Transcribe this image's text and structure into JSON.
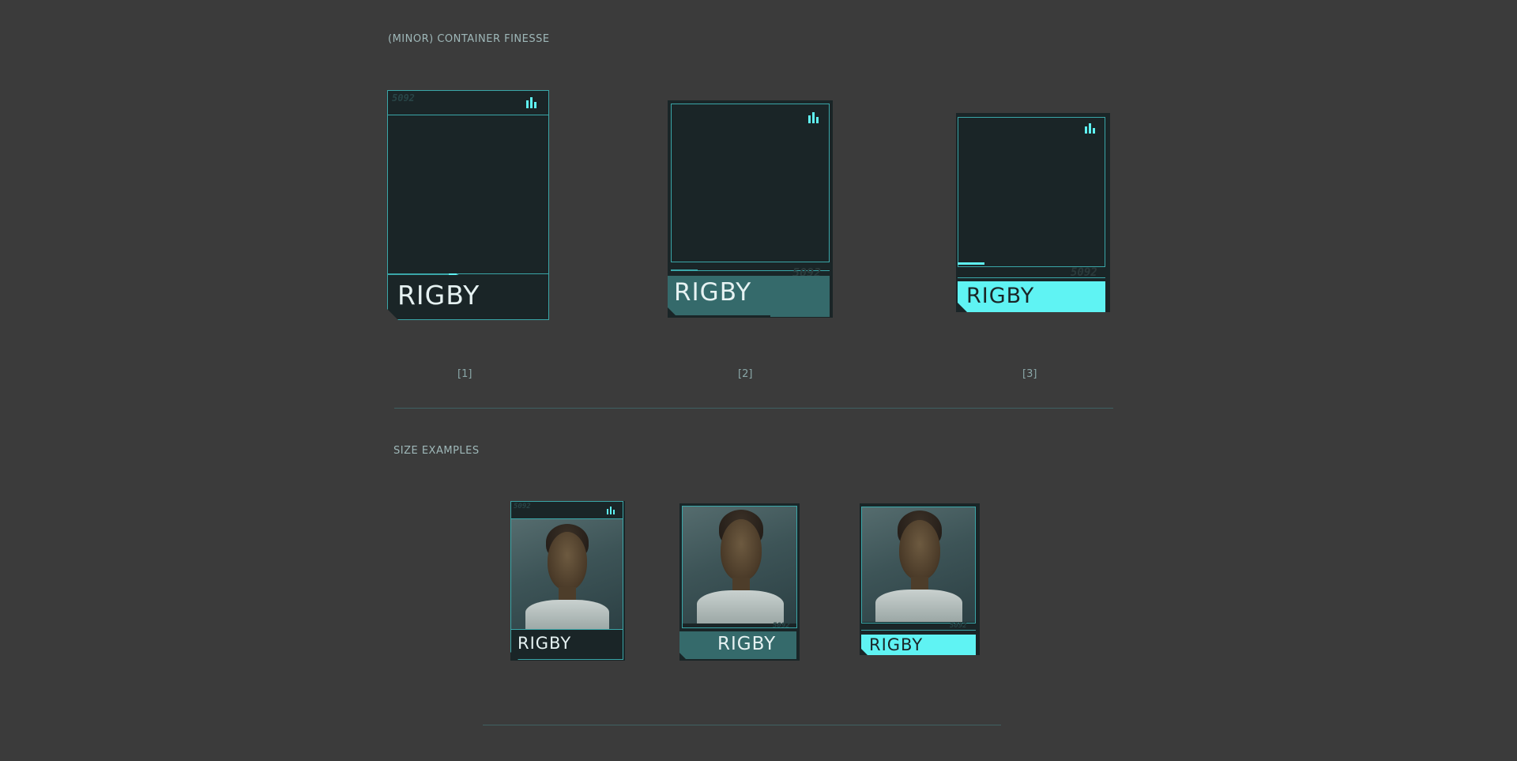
{
  "sections": {
    "finesse_title": "(MINOR) CONTAINER FINESSE",
    "size_title": "SIZE EXAMPLES"
  },
  "cards": [
    {
      "name": "RIGBY",
      "caption": "[1]",
      "tag": "5092",
      "variant": "outline"
    },
    {
      "name": "RIGBY",
      "caption": "[2]",
      "tag": "5092",
      "variant": "teal-fill"
    },
    {
      "name": "RIGBY",
      "caption": "[3]",
      "tag": "5092",
      "variant": "cyan-fill"
    }
  ],
  "size_cards": [
    {
      "name": "RIGBY",
      "tag": "5092"
    },
    {
      "name": "RIGBY",
      "tag": "5092"
    },
    {
      "name": "RIGBY",
      "tag": "5092"
    }
  ],
  "icons": {
    "stats": "bar-chart-icon"
  },
  "colors": {
    "background": "#3b3b3b",
    "panel": "#1a2527",
    "outline": "#3aa6a8",
    "teal": "#356a6b",
    "cyan": "#5ff3f3",
    "text_light": "#e6f2f2",
    "text_dark": "#1a2527"
  }
}
